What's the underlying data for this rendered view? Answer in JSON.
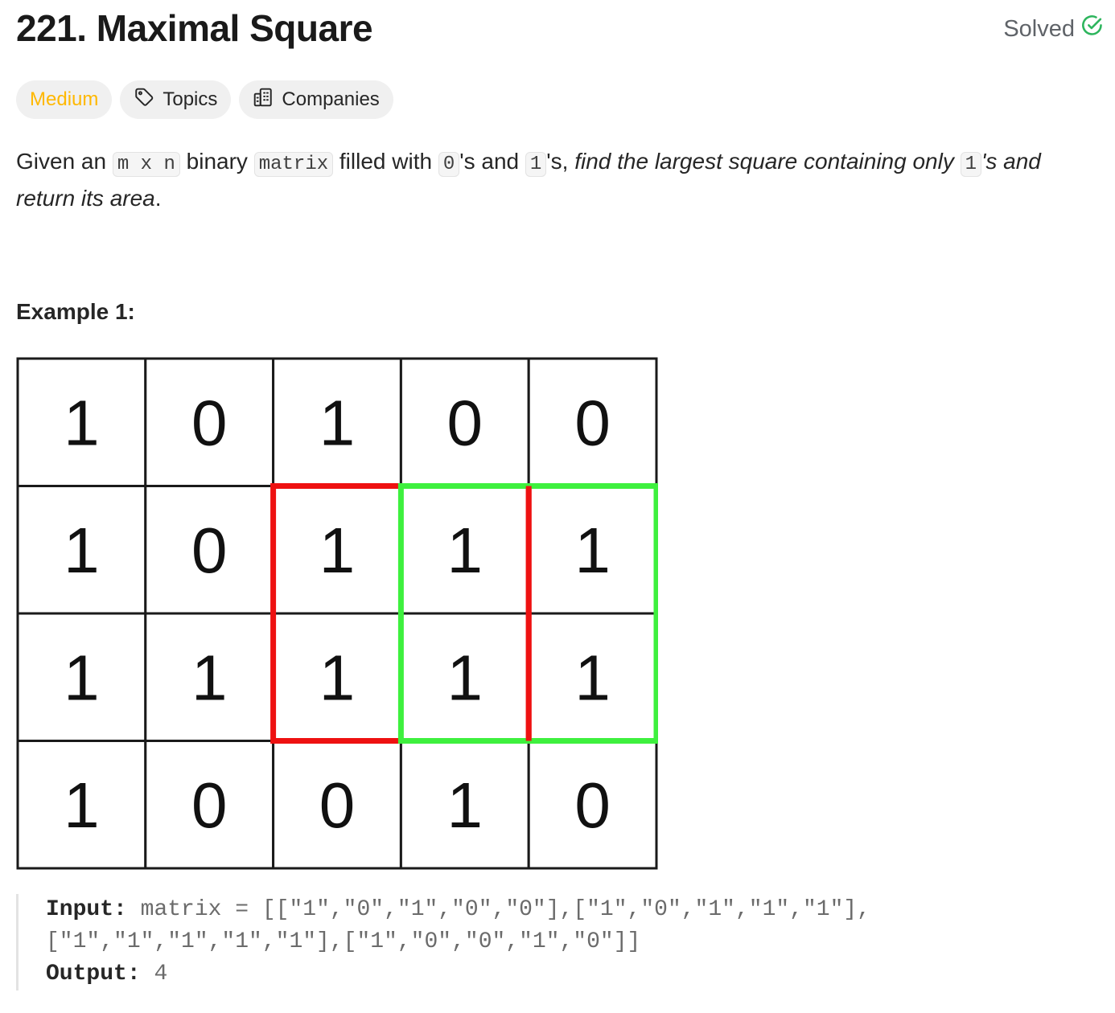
{
  "problem": {
    "title": "221. Maximal Square",
    "status": "Solved",
    "status_icon": "check-circle-icon",
    "status_color": "#2db55d"
  },
  "tags": {
    "difficulty": "Medium",
    "difficulty_color": "#ffb800",
    "topics": "Topics",
    "companies": "Companies"
  },
  "description": {
    "t1": "Given an ",
    "c1": "m x n",
    "t2": " binary ",
    "c2": "matrix",
    "t3": " filled with ",
    "c3": "0",
    "t4": "'s and ",
    "c4": "1",
    "t5": "'s, ",
    "i1": "find the largest square containing only ",
    "c5": "1",
    "i2": "'s and return its area",
    "t6": "."
  },
  "example": {
    "title": "Example 1:",
    "matrix": [
      [
        "1",
        "0",
        "1",
        "0",
        "0"
      ],
      [
        "1",
        "0",
        "1",
        "1",
        "1"
      ],
      [
        "1",
        "1",
        "1",
        "1",
        "1"
      ],
      [
        "1",
        "0",
        "0",
        "1",
        "0"
      ]
    ],
    "highlight_red": {
      "rows": [
        1,
        2
      ],
      "cols": [
        2,
        3
      ],
      "color": "#ee1111"
    },
    "highlight_green": {
      "rows": [
        1,
        2
      ],
      "cols": [
        3,
        4
      ],
      "color": "#3ef03e"
    },
    "input_label": "Input:",
    "input_line1": "matrix = [[\"1\",\"0\",\"1\",\"0\",\"0\"],[\"1\",\"0\",\"1\",\"1\",\"1\"],",
    "input_line2": "[\"1\",\"1\",\"1\",\"1\",\"1\"],[\"1\",\"0\",\"0\",\"1\",\"0\"]]",
    "output_label": "Output:",
    "output_value": "4"
  }
}
